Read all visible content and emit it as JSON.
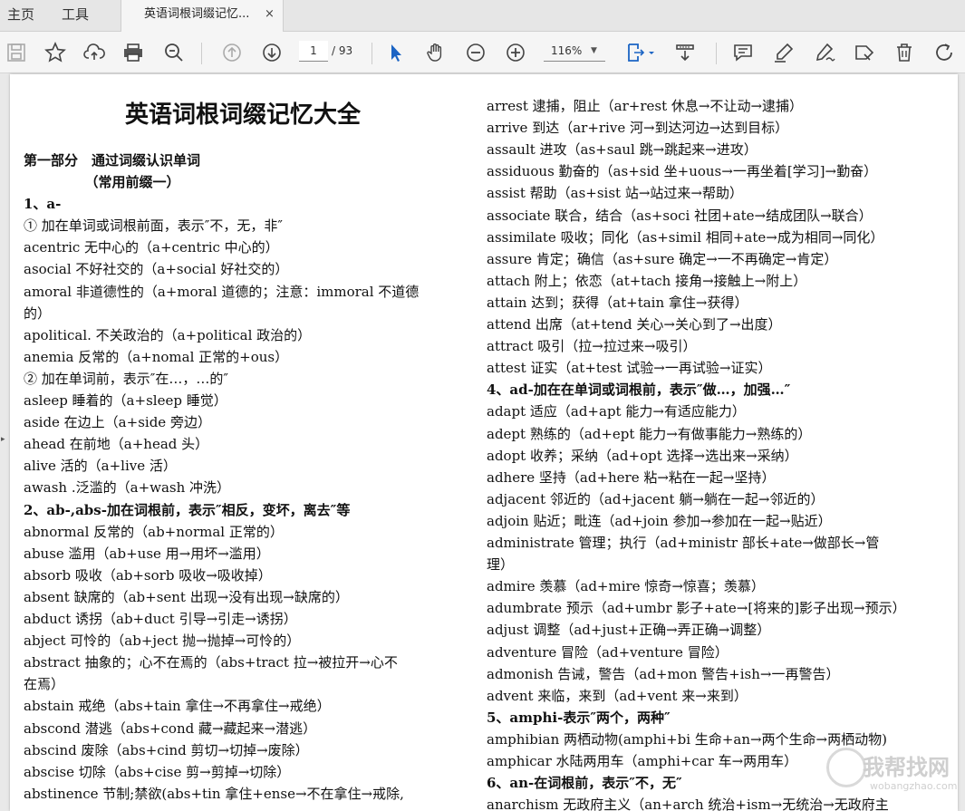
{
  "tabs": {
    "home": "主页",
    "tools": "工具",
    "doc": "英语词根词缀记忆...",
    "close": "×"
  },
  "toolbar": {
    "page_current": "1",
    "page_total": "/ 93",
    "zoom": "116%"
  },
  "watermark": {
    "main": "我帮找网",
    "url": "wobangzhao.com"
  },
  "content": {
    "left": [
      {
        "text": "英语词根词缀记忆大全",
        "style": "h1"
      },
      {
        "text": "第一部分　通过词缀认识单词",
        "style": "b"
      },
      {
        "text": "　　　　　（常用前缀一）",
        "style": "b"
      },
      {
        "text": "1、a-",
        "style": "b"
      },
      {
        "text": "① 加在单词或词根前面，表示″不，无，非″",
        "style": ""
      },
      {
        "text": "acentric 无中心的（a+centric 中心的）",
        "style": ""
      },
      {
        "text": "asocial 不好社交的（a+social 好社交的）",
        "style": ""
      },
      {
        "text": "amoral 非道德性的（a+moral 道德的；注意：immoral 不道德",
        "style": ""
      },
      {
        "text": "的）",
        "style": ""
      },
      {
        "text": "apolitical. 不关政治的（a+political 政治的）",
        "style": ""
      },
      {
        "text": "anemia 反常的（a+nomal 正常的+ous）",
        "style": ""
      },
      {
        "text": "② 加在单词前，表示″在…，…的″",
        "style": ""
      },
      {
        "text": "asleep 睡着的（a+sleep 睡觉）",
        "style": ""
      },
      {
        "text": "aside 在边上（a+side 旁边）",
        "style": ""
      },
      {
        "text": "ahead 在前地（a+head 头）",
        "style": ""
      },
      {
        "text": "alive 活的（a+live 活）",
        "style": ""
      },
      {
        "text": "awash .泛滥的（a+wash 冲洗）",
        "style": ""
      },
      {
        "text": "2、ab-,abs-加在词根前，表示″相反，变坏，离去″等",
        "style": "b"
      },
      {
        "text": "abnormal 反常的（ab+normal 正常的）",
        "style": ""
      },
      {
        "text": "abuse 滥用（ab+use 用→用坏→滥用）",
        "style": ""
      },
      {
        "text": "absorb 吸收（ab+sorb 吸收→吸收掉）",
        "style": ""
      },
      {
        "text": "absent 缺席的（ab+sent 出现→没有出现→缺席的）",
        "style": ""
      },
      {
        "text": "abduct 诱拐（ab+duct 引导→引走→诱拐）",
        "style": ""
      },
      {
        "text": "abject 可怜的（ab+ject 抛→抛掉→可怜的）",
        "style": ""
      },
      {
        "text": "abstract 抽象的；心不在焉的（abs+tract 拉→被拉开→心不",
        "style": ""
      },
      {
        "text": "在焉）",
        "style": ""
      },
      {
        "text": "abstain 戒绝（abs+tain 拿住→不再拿住→戒绝）",
        "style": ""
      },
      {
        "text": "abscond 潜逃（abs+cond 藏→藏起来→潜逃）",
        "style": ""
      },
      {
        "text": "abscind 废除（abs+cind 剪切→切掉→废除）",
        "style": ""
      },
      {
        "text": "abscise 切除（abs+cise 剪→剪掉→切除）",
        "style": ""
      },
      {
        "text": "abstinence 节制;禁欲(abs+tin 拿住+ense→不在拿住→戒除,",
        "style": ""
      }
    ],
    "right": [
      {
        "text": "arrest 逮捕，阻止（ar+rest 休息→不让动→逮捕）",
        "style": ""
      },
      {
        "text": "arrive 到达（ar+rive 河→到达河边→达到目标）",
        "style": ""
      },
      {
        "text": "assault 进攻（as+saul 跳→跳起来→进攻）",
        "style": ""
      },
      {
        "text": "assiduous 勤奋的（as+sid 坐+uous→一再坐着[学习]→勤奋）",
        "style": ""
      },
      {
        "text": "assist 帮助（as+sist 站→站过来→帮助）",
        "style": ""
      },
      {
        "text": "associate 联合，结合（as+soci 社团+ate→结成团队→联合）",
        "style": ""
      },
      {
        "text": "assimilate 吸收；同化（as+simil 相同+ate→成为相同→同化）",
        "style": ""
      },
      {
        "text": "assure 肯定；确信（as+sure 确定→一不再确定→肯定）",
        "style": ""
      },
      {
        "text": "attach 附上；依恋（at+tach 接角→接触上→附上）",
        "style": ""
      },
      {
        "text": "attain 达到；获得（at+tain 拿住→获得）",
        "style": ""
      },
      {
        "text": "attend 出席（at+tend 关心→关心到了→出度）",
        "style": ""
      },
      {
        "text": "attract 吸引（拉→拉过来→吸引）",
        "style": ""
      },
      {
        "text": "attest 证实（at+test 试验→一再试验→证实）",
        "style": ""
      },
      {
        "text": "4、ad-加在在单词或词根前，表示″做…，加强…″",
        "style": "b"
      },
      {
        "text": "adapt 适应（ad+apt 能力→有适应能力）",
        "style": ""
      },
      {
        "text": "adept 熟练的（ad+ept 能力→有做事能力→熟练的）",
        "style": ""
      },
      {
        "text": "adopt 收养；采纳（ad+opt 选择→选出来→采纳）",
        "style": ""
      },
      {
        "text": "adhere 坚持（ad+here 粘→粘在一起→坚持）",
        "style": ""
      },
      {
        "text": "adjacent 邻近的（ad+jacent 躺→躺在一起→邻近的）",
        "style": ""
      },
      {
        "text": "adjoin 贴近；毗连（ad+join 参加→参加在一起→贴近）",
        "style": ""
      },
      {
        "text": "administrate 管理；执行（ad+ministr 部长+ate→做部长→管",
        "style": ""
      },
      {
        "text": "理）",
        "style": ""
      },
      {
        "text": "admire 羡慕（ad+mire 惊奇→惊喜；羡慕）",
        "style": ""
      },
      {
        "text": "adumbrate 预示（ad+umbr 影子+ate→[将来的]影子出现→预示）",
        "style": ""
      },
      {
        "text": "adjust 调整（ad+just+正确→弄正确→调整）",
        "style": ""
      },
      {
        "text": "adventure 冒险（ad+venture 冒险）",
        "style": ""
      },
      {
        "text": "admonish 告诫，警告（ad+mon 警告+ish→一再警告）",
        "style": ""
      },
      {
        "text": "advent 来临，来到（ad+vent 来→来到）",
        "style": ""
      },
      {
        "text": "5、amphi-表示″两个，两种″",
        "style": "b"
      },
      {
        "text": "amphibian 两栖动物(amphi+bi 生命+an→两个生命→两栖动物)",
        "style": ""
      },
      {
        "text": "amphicar 水陆两用车（amphi+car 车→两用车）",
        "style": ""
      },
      {
        "text": "6、an-在词根前，表示″不，无″",
        "style": "b"
      },
      {
        "text": "anarchism 无政府主义（an+arch 统治+ism→无统治→无政府主",
        "style": ""
      }
    ]
  }
}
